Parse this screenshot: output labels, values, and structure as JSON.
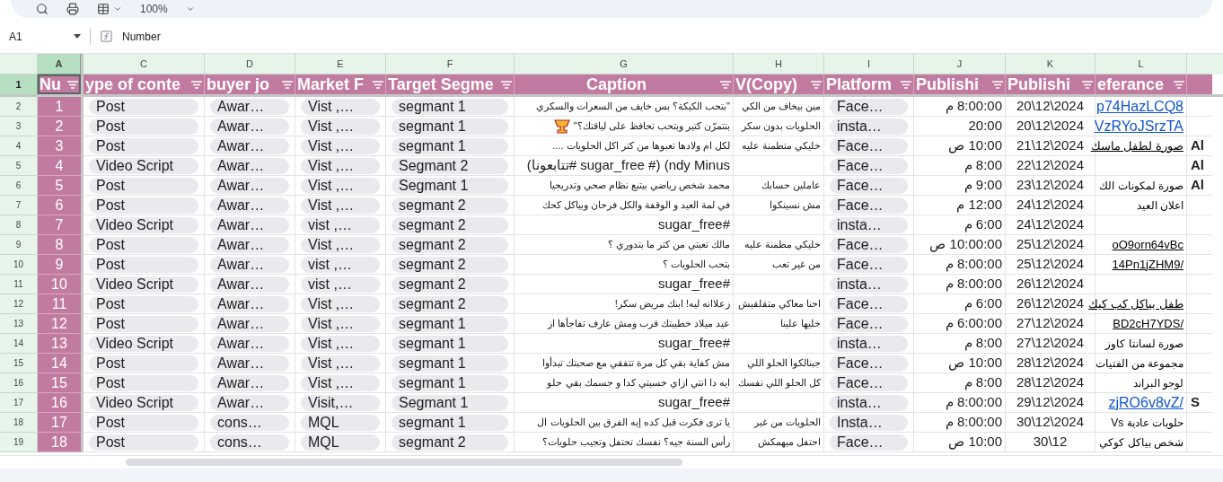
{
  "toolbar": {
    "zoom": "100%"
  },
  "formula_bar": {
    "cell_ref": "A1",
    "formula": "Number"
  },
  "column_letters": [
    {
      "label": "A",
      "selected": true
    },
    {
      "label": "C",
      "selected": false
    },
    {
      "label": "D",
      "selected": false
    },
    {
      "label": "E",
      "selected": false
    },
    {
      "label": "F",
      "selected": false
    },
    {
      "label": "G",
      "selected": false
    },
    {
      "label": "H",
      "selected": false
    },
    {
      "label": "I",
      "selected": false
    },
    {
      "label": "J",
      "selected": false
    },
    {
      "label": "K",
      "selected": false
    },
    {
      "label": "L",
      "selected": false
    }
  ],
  "header_row": {
    "row_number": "1",
    "selected": true,
    "labels": [
      "Nu",
      "ype of conte",
      "buyer jo",
      "Market F",
      "Target Segme",
      "Caption",
      "V(Copy)",
      "Platform",
      "Publishi",
      "Publishi",
      "eferance"
    ]
  },
  "rows": [
    {
      "row_number": "2",
      "number": "1",
      "type": "Post",
      "journey": "Awar…",
      "market": "Vist ,…",
      "segment": "segmant 1",
      "caption": "\"بتحب الكيكة؟ بس خايف من السعرات والسكري",
      "pov": "مين بيخاف من الكي",
      "platform": "Face…",
      "time": "8:00:00 م",
      "date": "20\\12\\2024",
      "reference": "p74HazLCQ8",
      "link": true,
      "underlined": true
    },
    {
      "row_number": "3",
      "number": "2",
      "type": "Post",
      "journey": "Awar…",
      "market": "Vist ,…",
      "segment": "segmant 1",
      "caption": "بتتمرّن كتير وبتحب تحافظ على لياقتك؟\"",
      "caption_emoji": true,
      "pov": "الحلويات بدون سكر",
      "platform": "insta…",
      "time": "20:00",
      "date": "20\\12\\2024",
      "reference": "VzRYoJSrzTA",
      "link": true,
      "underlined": true
    },
    {
      "row_number": "4",
      "number": "3",
      "type": "Post",
      "journey": "Awar…",
      "market": "Vist ,…",
      "segment": "segmant 1",
      "caption": "لكل ام ولادها تعبوها من كتر اكل الحلويات ....",
      "pov": "خليكي متطمنة عليه",
      "platform": "Face…",
      "time": "10:00 ص",
      "date": "21\\12\\2024",
      "reference": "صورة لطفل ماسك",
      "link": false,
      "underlined": true,
      "extra": "Al"
    },
    {
      "row_number": "5",
      "number": "4",
      "type": "Video Script",
      "journey": "Awar…",
      "market": "Vist ,…",
      "segment": "Segmant 2",
      "caption": "ndy Minus) (#   sugar_free #تتابعونا)",
      "platform": "Face…",
      "time": "8:00 م",
      "date": "22\\12\\2024",
      "extra": "Al"
    },
    {
      "row_number": "6",
      "number": "5",
      "type": "Post",
      "journey": "Awar…",
      "market": "Vist ,…",
      "segment": "Segmant 1",
      "caption": "محمد شخص رياضي بيتبع نظام صحي وتدريجيا",
      "pov": "عاملين حسابك",
      "platform": "Face…",
      "time": "9:00 م",
      "date": "23\\12\\2024",
      "reference": "صورة لمكونات الك",
      "link": false,
      "underlined": false,
      "extra": "Al"
    },
    {
      "row_number": "7",
      "number": "6",
      "type": "Post",
      "journey": "Awar…",
      "market": "Vist ,…",
      "segment": "segmant 2",
      "caption": "في لمة العيد و الوقفة والكل فرحان وبياكل كحك",
      "pov": "مش نسينكوا",
      "platform": "Face…",
      "time": "12:00 م",
      "date": "24\\12\\2024",
      "reference": "اعلان العيد",
      "link": false,
      "underlined": false
    },
    {
      "row_number": "8",
      "number": "7",
      "type": "Video Script",
      "journey": "Awar…",
      "market": "vist ,…",
      "segment": "segmant 2",
      "caption": "#sugar_free",
      "platform": "insta…",
      "time": "6:00 م",
      "date": "24\\12\\2024"
    },
    {
      "row_number": "9",
      "number": "8",
      "type": "Post",
      "journey": "Awar…",
      "market": "Vist ,…",
      "segment": "segmant 2",
      "caption": "مالك تعبتي من كتر ما بتدوري ؟",
      "pov": "خليكي مطمنة عليه",
      "platform": "Face…",
      "time": "10:00:00 ص",
      "date": "25\\12\\2024",
      "reference": "oO9orn64vBc",
      "link": false,
      "underlined": true
    },
    {
      "row_number": "10",
      "number": "9",
      "type": "Post",
      "journey": "Awar…",
      "market": "vist ,…",
      "segment": "segmant 2",
      "caption": "بتحب الحلويات ؟",
      "pov": "من غير تعب",
      "platform": "Face…",
      "time": "8:00:00 م",
      "date": "25\\12\\2024",
      "reference": "14Pn1jZHM9/",
      "link": false,
      "underlined": true
    },
    {
      "row_number": "11",
      "number": "10",
      "type": "Video Script",
      "journey": "Awar…",
      "market": "vist ,…",
      "segment": "segmant 2",
      "caption": "#sugar_free",
      "platform": "insta…",
      "time": "8:00:00 م",
      "date": "26\\12\\2024"
    },
    {
      "row_number": "12",
      "number": "11",
      "type": "Post",
      "journey": "Awar…",
      "market": "Vist ,…",
      "segment": "segmant 2",
      "caption": "زعلاانه ليه! ابنك مريض سكر!",
      "pov": "احنا معاكي متقلقيش",
      "platform": "Face…",
      "time": "6:00 م",
      "date": "26\\12\\2024",
      "reference": "طفل بياكل كب كيك",
      "link": false,
      "underlined": true
    },
    {
      "row_number": "13",
      "number": "12",
      "type": "Post",
      "journey": "Awar…",
      "market": "Vist ,…",
      "segment": "segmant 1",
      "caption": "عيد ميلاد خطيبتك قرب ومش عارف تفاجأها از",
      "pov": "خليها علينا",
      "platform": "Face…",
      "time": "6:00:00 م",
      "date": "27\\12\\2024",
      "reference": "BD2cH7YDS/",
      "link": false,
      "underlined": true
    },
    {
      "row_number": "14",
      "number": "13",
      "type": "Video Script",
      "journey": "Awar…",
      "market": "Vist ,…",
      "segment": "segmant 1",
      "caption": "#sugar_free",
      "platform": "insta…",
      "time": "8:00 م",
      "date": "27\\12\\2024",
      "reference": "صورة لسانتا كاوز",
      "link": false,
      "underlined": false
    },
    {
      "row_number": "15",
      "number": "14",
      "type": "Post",
      "journey": "Awar…",
      "market": "Vist ,…",
      "segment": "segmant 1",
      "caption": "مش كفاية بقي كل مرة تتفقي مع صحبتك تبدأوا",
      "pov": "جبنالكوا الحلو اللي",
      "platform": "Face…",
      "time": "10:00 ص",
      "date": "28\\12\\2024",
      "reference": "مجموعة من الفتيات",
      "link": false,
      "underlined": false
    },
    {
      "row_number": "16",
      "number": "15",
      "type": "Post",
      "journey": "Awar…",
      "market": "Vist ,…",
      "segment": "segmant 1",
      "caption": "ايه دا انتي ازاي خسيتي كدا و جسمك بقي حلو",
      "pov": "كل الحلو اللي نفسك",
      "platform": "Face…",
      "time": "8:00 م",
      "date": "28\\12\\2024",
      "reference": "لوجو البراند",
      "link": false,
      "underlined": false
    },
    {
      "row_number": "17",
      "number": "16",
      "type": "Video Script",
      "journey": "Awar…",
      "market": "Visit,…",
      "segment": "Segmant 1",
      "caption": "#sugar_free",
      "platform": "insta…",
      "time": "8:00:00 م",
      "date": "29\\12\\2024",
      "reference": "zjRO6v8vZ/",
      "link": true,
      "underlined": true,
      "extra": "S"
    },
    {
      "row_number": "18",
      "number": "17",
      "type": "Post",
      "journey": "cons…",
      "market": "MQL",
      "segment": "segmant 1",
      "caption": "يا ترى فكرت قبل كده إيه الفرق بين الحلويات ال",
      "pov": "الحلويات من غير",
      "platform": "Insta…",
      "time": "8:00:00 م",
      "date": "30\\12\\2024",
      "reference": "حلويات عادية Vs",
      "link": false,
      "underlined": false
    },
    {
      "row_number": "19",
      "number": "18",
      "type": "Post",
      "journey": "cons…",
      "market": "MQL",
      "segment": "segmant 2",
      "caption": "رأس السنة جيه؟ نفسك تحتفل وتجيب حلويات؟",
      "pov": "احتفل ميهمكش",
      "platform": "Face…",
      "time": "10:00 ص",
      "date": "30\\12",
      "reference": "شخص بياكل كوكي",
      "link": false,
      "underlined": false
    }
  ]
}
